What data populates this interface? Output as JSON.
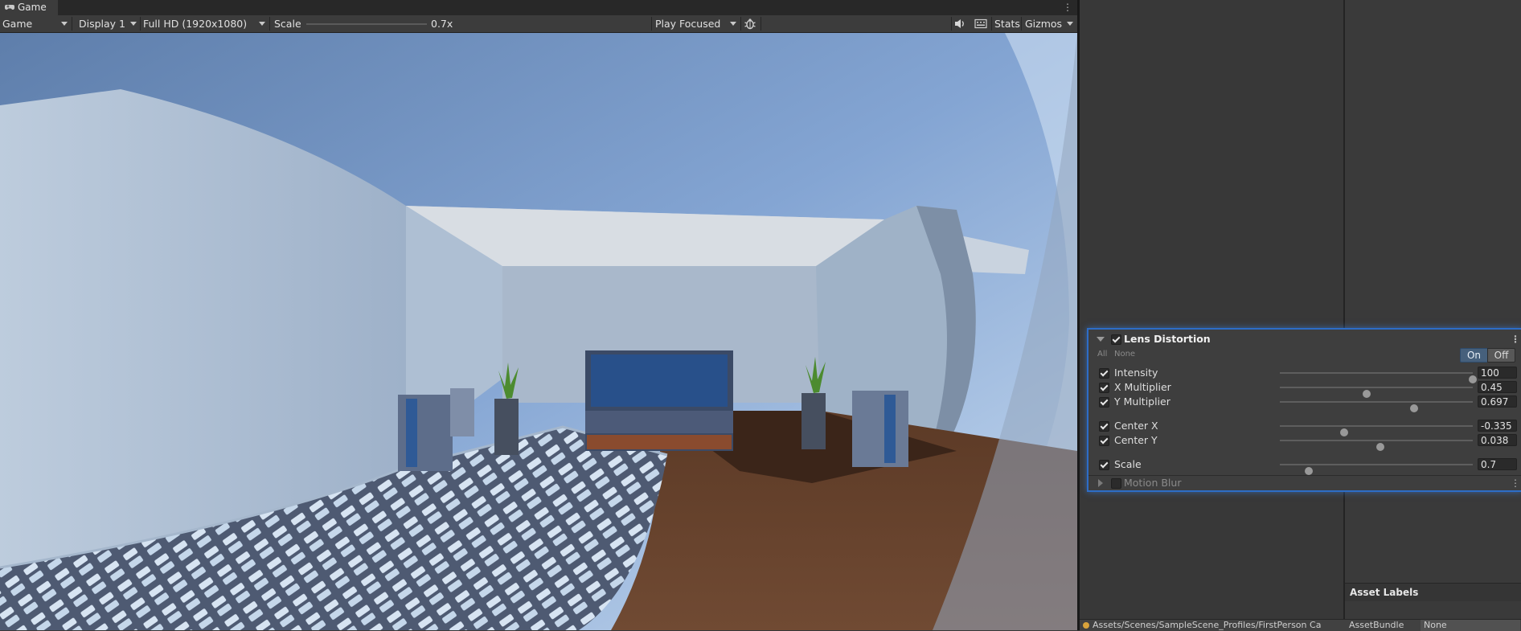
{
  "game_window": {
    "tab_label": "Game",
    "toolbar": {
      "mode": "Game",
      "display": "Display 1",
      "resolution": "Full HD (1920x1080)",
      "scale_label": "Scale",
      "scale_value": "0.7x",
      "play_mode": "Play Focused",
      "stats": "Stats",
      "gizmos": "Gizmos"
    }
  },
  "icons": {
    "tab": "gamepad-icon",
    "bug": "bug-icon",
    "audio": "speaker-icon",
    "grid": "keyboard-icon",
    "menu": "kebab-menu-icon"
  },
  "lens_panel": {
    "title": "Lens Distortion",
    "enabled": true,
    "all_label": "All",
    "none_label": "None",
    "on_label": "On",
    "off_label": "Off",
    "params": [
      {
        "label": "Intensity",
        "value": "100",
        "fraction": 1.0,
        "checked": true
      },
      {
        "label": "X Multiplier",
        "value": "0.45",
        "fraction": 0.45,
        "checked": true
      },
      {
        "label": "Y Multiplier",
        "value": "0.697",
        "fraction": 0.697,
        "checked": true
      },
      {
        "label": "Center X",
        "value": "-0.335",
        "fraction": 0.3325,
        "checked": true
      },
      {
        "label": "Center Y",
        "value": "0.038",
        "fraction": 0.519,
        "checked": true
      },
      {
        "label": "Scale",
        "value": "0.7",
        "fraction": 0.15,
        "checked": true
      }
    ],
    "next_override": "Motion Blur"
  },
  "right_panel": {
    "asset_labels_title": "Asset Labels",
    "assetbundle_label": "AssetBundle",
    "assetbundle_value": "None"
  },
  "bottom_path": "Assets/Scenes/SampleScene_Profiles/FirstPerson Ca"
}
